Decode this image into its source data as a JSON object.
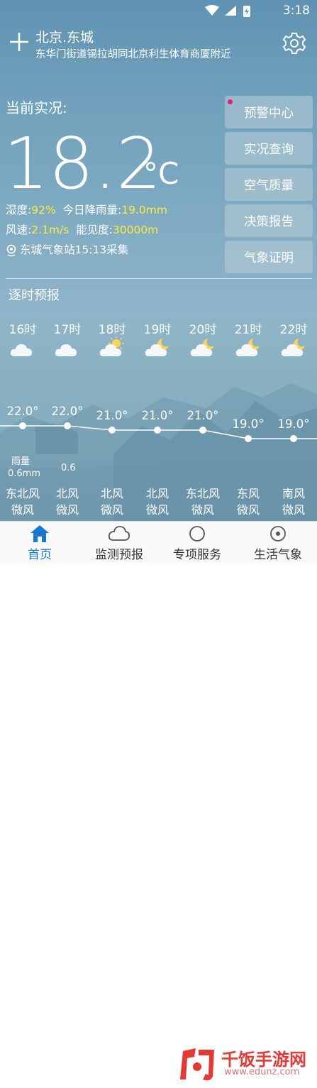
{
  "status": {
    "time": "3:18"
  },
  "location": {
    "city": "北京.东城",
    "address": "东华门街道锡拉胡同北京利生体育商厦附近"
  },
  "current": {
    "label": "当前实况:",
    "temperature": "18.2",
    "unit": "°C",
    "humidity_label": "湿度:",
    "humidity": "92%",
    "rain_label": "今日降雨量:",
    "rain": "19.0mm",
    "wind_label": "风速:",
    "wind_speed": "2.1m/s",
    "visibility_label": "能见度:",
    "visibility": "30000m",
    "station": "东城气象站15:13采集"
  },
  "side_buttons": [
    "预警中心",
    "实况查询",
    "空气质量",
    "决策报告",
    "气象证明"
  ],
  "hourly": {
    "title": "逐时预报",
    "items": [
      {
        "hour": "16时",
        "icon": "cloud-icon",
        "temp": "22.0°",
        "temp_value": 22.0,
        "wind_dir": "东北风",
        "wind_level": "微风"
      },
      {
        "hour": "17时",
        "icon": "cloud-icon",
        "temp": "22.0°",
        "temp_value": 22.0,
        "wind_dir": "北风",
        "wind_level": "微风"
      },
      {
        "hour": "18时",
        "icon": "sun-cloud-icon",
        "temp": "21.0°",
        "temp_value": 21.0,
        "wind_dir": "北风",
        "wind_level": "微风"
      },
      {
        "hour": "19时",
        "icon": "moon-cloud-icon",
        "temp": "21.0°",
        "temp_value": 21.0,
        "wind_dir": "北风",
        "wind_level": "微风"
      },
      {
        "hour": "20时",
        "icon": "moon-cloud-icon",
        "temp": "21.0°",
        "temp_value": 21.0,
        "wind_dir": "东北风",
        "wind_level": "微风"
      },
      {
        "hour": "21时",
        "icon": "moon-cloud-icon",
        "temp": "19.0°",
        "temp_value": 19.0,
        "wind_dir": "东风",
        "wind_level": "微风"
      },
      {
        "hour": "22时",
        "icon": "moon-cloud-icon",
        "temp": "19.0°",
        "temp_value": 19.0,
        "wind_dir": "南风",
        "wind_level": "微风"
      }
    ],
    "rain_label": "雨量",
    "rain_values": [
      "0.6mm",
      "0.6"
    ]
  },
  "tabs": [
    {
      "label": "首页",
      "icon": "home-icon",
      "active": true
    },
    {
      "label": "监测预报",
      "icon": "cloud-outline-icon",
      "active": false
    },
    {
      "label": "专项服务",
      "icon": "service-icon",
      "active": false
    },
    {
      "label": "生活气象",
      "icon": "life-icon",
      "active": false
    }
  ],
  "watermark": {
    "text": "千饭手游网",
    "url": "www.edunz.com"
  },
  "colors": {
    "accent": "#1976d2",
    "highlight": "#ffeb3b",
    "alert_dot": "#e91e63"
  }
}
